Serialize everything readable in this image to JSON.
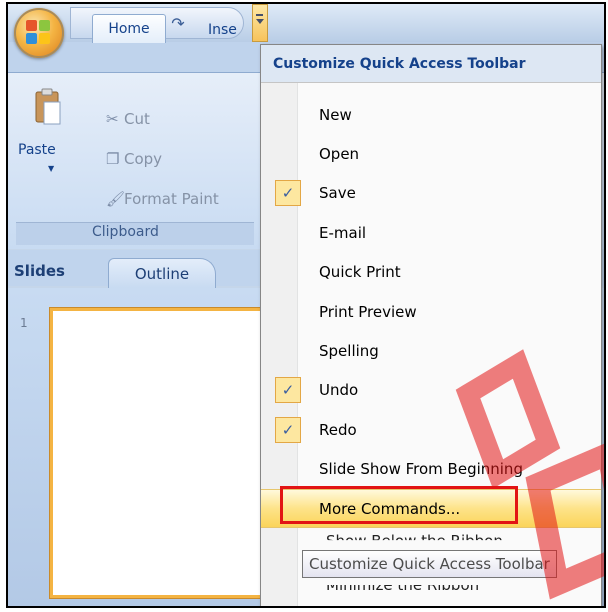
{
  "ribbon": {
    "home_tab": "Home",
    "insert_tab_partial": "Inse",
    "clipboard_group": "Clipboard",
    "paste": "Paste",
    "cut": "Cut",
    "copy": "Copy",
    "format_painter_partial": "Format Paint"
  },
  "slides_pane": {
    "slides_tab": "Slides",
    "outline_tab": "Outline",
    "slide_number": "1"
  },
  "menu": {
    "header": "Customize Quick Access Toolbar",
    "items": [
      {
        "label": "New",
        "checked": false
      },
      {
        "label": "Open",
        "checked": false
      },
      {
        "label": "Save",
        "checked": true
      },
      {
        "label": "E-mail",
        "checked": false
      },
      {
        "label": "Quick Print",
        "checked": false
      },
      {
        "label": "Print Preview",
        "checked": false
      },
      {
        "label": "Spelling",
        "checked": false
      },
      {
        "label": "Undo",
        "checked": true
      },
      {
        "label": "Redo",
        "checked": true
      },
      {
        "label": "Slide Show From Beginning",
        "checked": false
      },
      {
        "label": "More Commands...",
        "checked": false
      }
    ],
    "partial_below": "Show Below the Ribbon",
    "partial_minimize": "Minimize the Ribbon"
  },
  "tooltip": "Customize Quick Access Toolbar",
  "check_glyph": "✓",
  "colors": {
    "accent_red": "#e21414",
    "highlight": "#fde389"
  }
}
